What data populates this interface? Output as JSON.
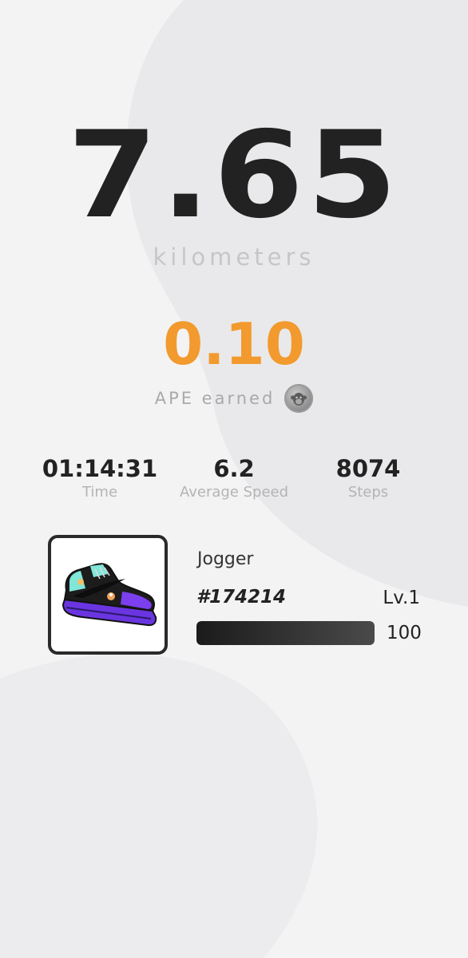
{
  "workout": {
    "distance_value": "7.65",
    "distance_unit": "kilometers",
    "earned_value": "0.10",
    "earned_label": "APE earned",
    "coin_icon": "ape-coin-icon"
  },
  "stats": [
    {
      "value": "01:14:31",
      "label": "Time"
    },
    {
      "value": "6.2",
      "label": "Average Speed"
    },
    {
      "value": "8074",
      "label": "Steps"
    }
  ],
  "sneaker": {
    "name": "Jogger",
    "id": "#174214",
    "level": "Lv.1",
    "progress_value": "100",
    "progress_fraction": 1.0,
    "image_icon": "sneaker-image"
  },
  "colors": {
    "background": "#f3f3f4",
    "accent": "#f29a2e",
    "text": "#222222",
    "muted": "#b4b4b6"
  }
}
